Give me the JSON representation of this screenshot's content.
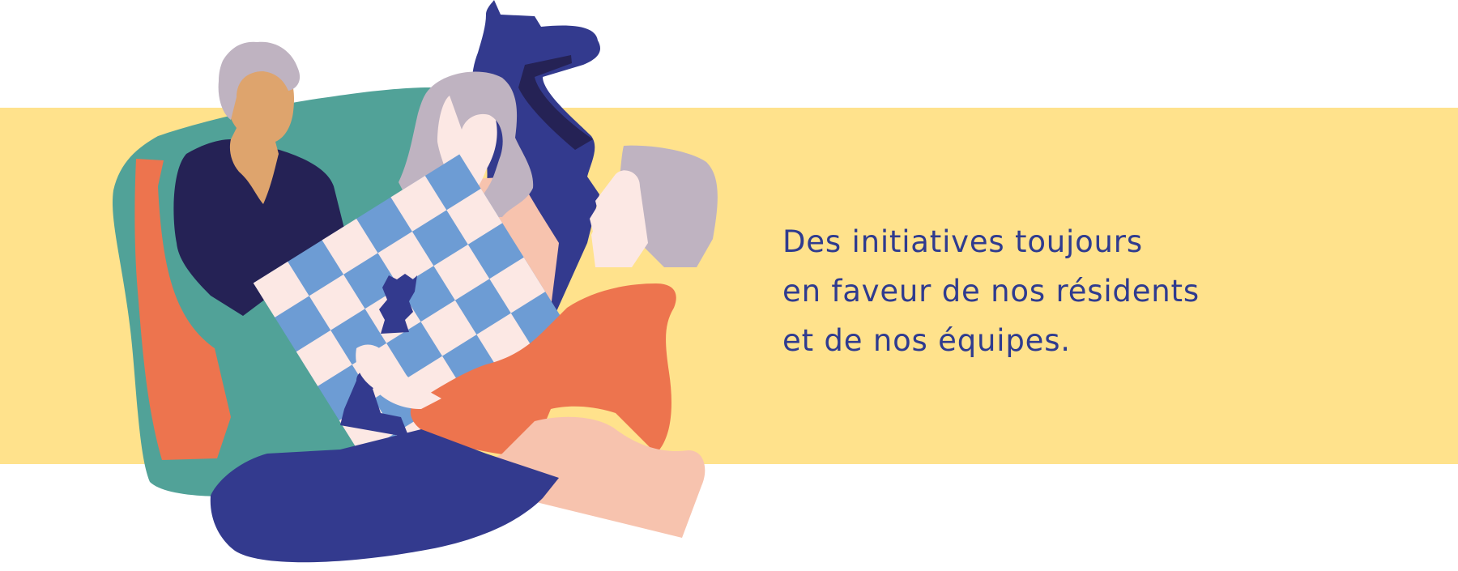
{
  "banner": {
    "color": "#FFE28C"
  },
  "illustration": {
    "subject": "three seniors playing chess",
    "palette": {
      "teal": "#51A298",
      "navy": "#252255",
      "royal_blue": "#333A8E",
      "orange": "#ED744E",
      "peach": "#F7C3AE",
      "skin_tan": "#DEA46D",
      "grey_hair": "#BFB3C1",
      "light_skin": "#FCE8E4",
      "board_blue": "#6D9CD4"
    }
  },
  "tagline": {
    "lines": [
      "Des initiatives toujours",
      "en faveur de nos résidents",
      "et de nos équipes."
    ],
    "color": "#2F3B8F"
  }
}
